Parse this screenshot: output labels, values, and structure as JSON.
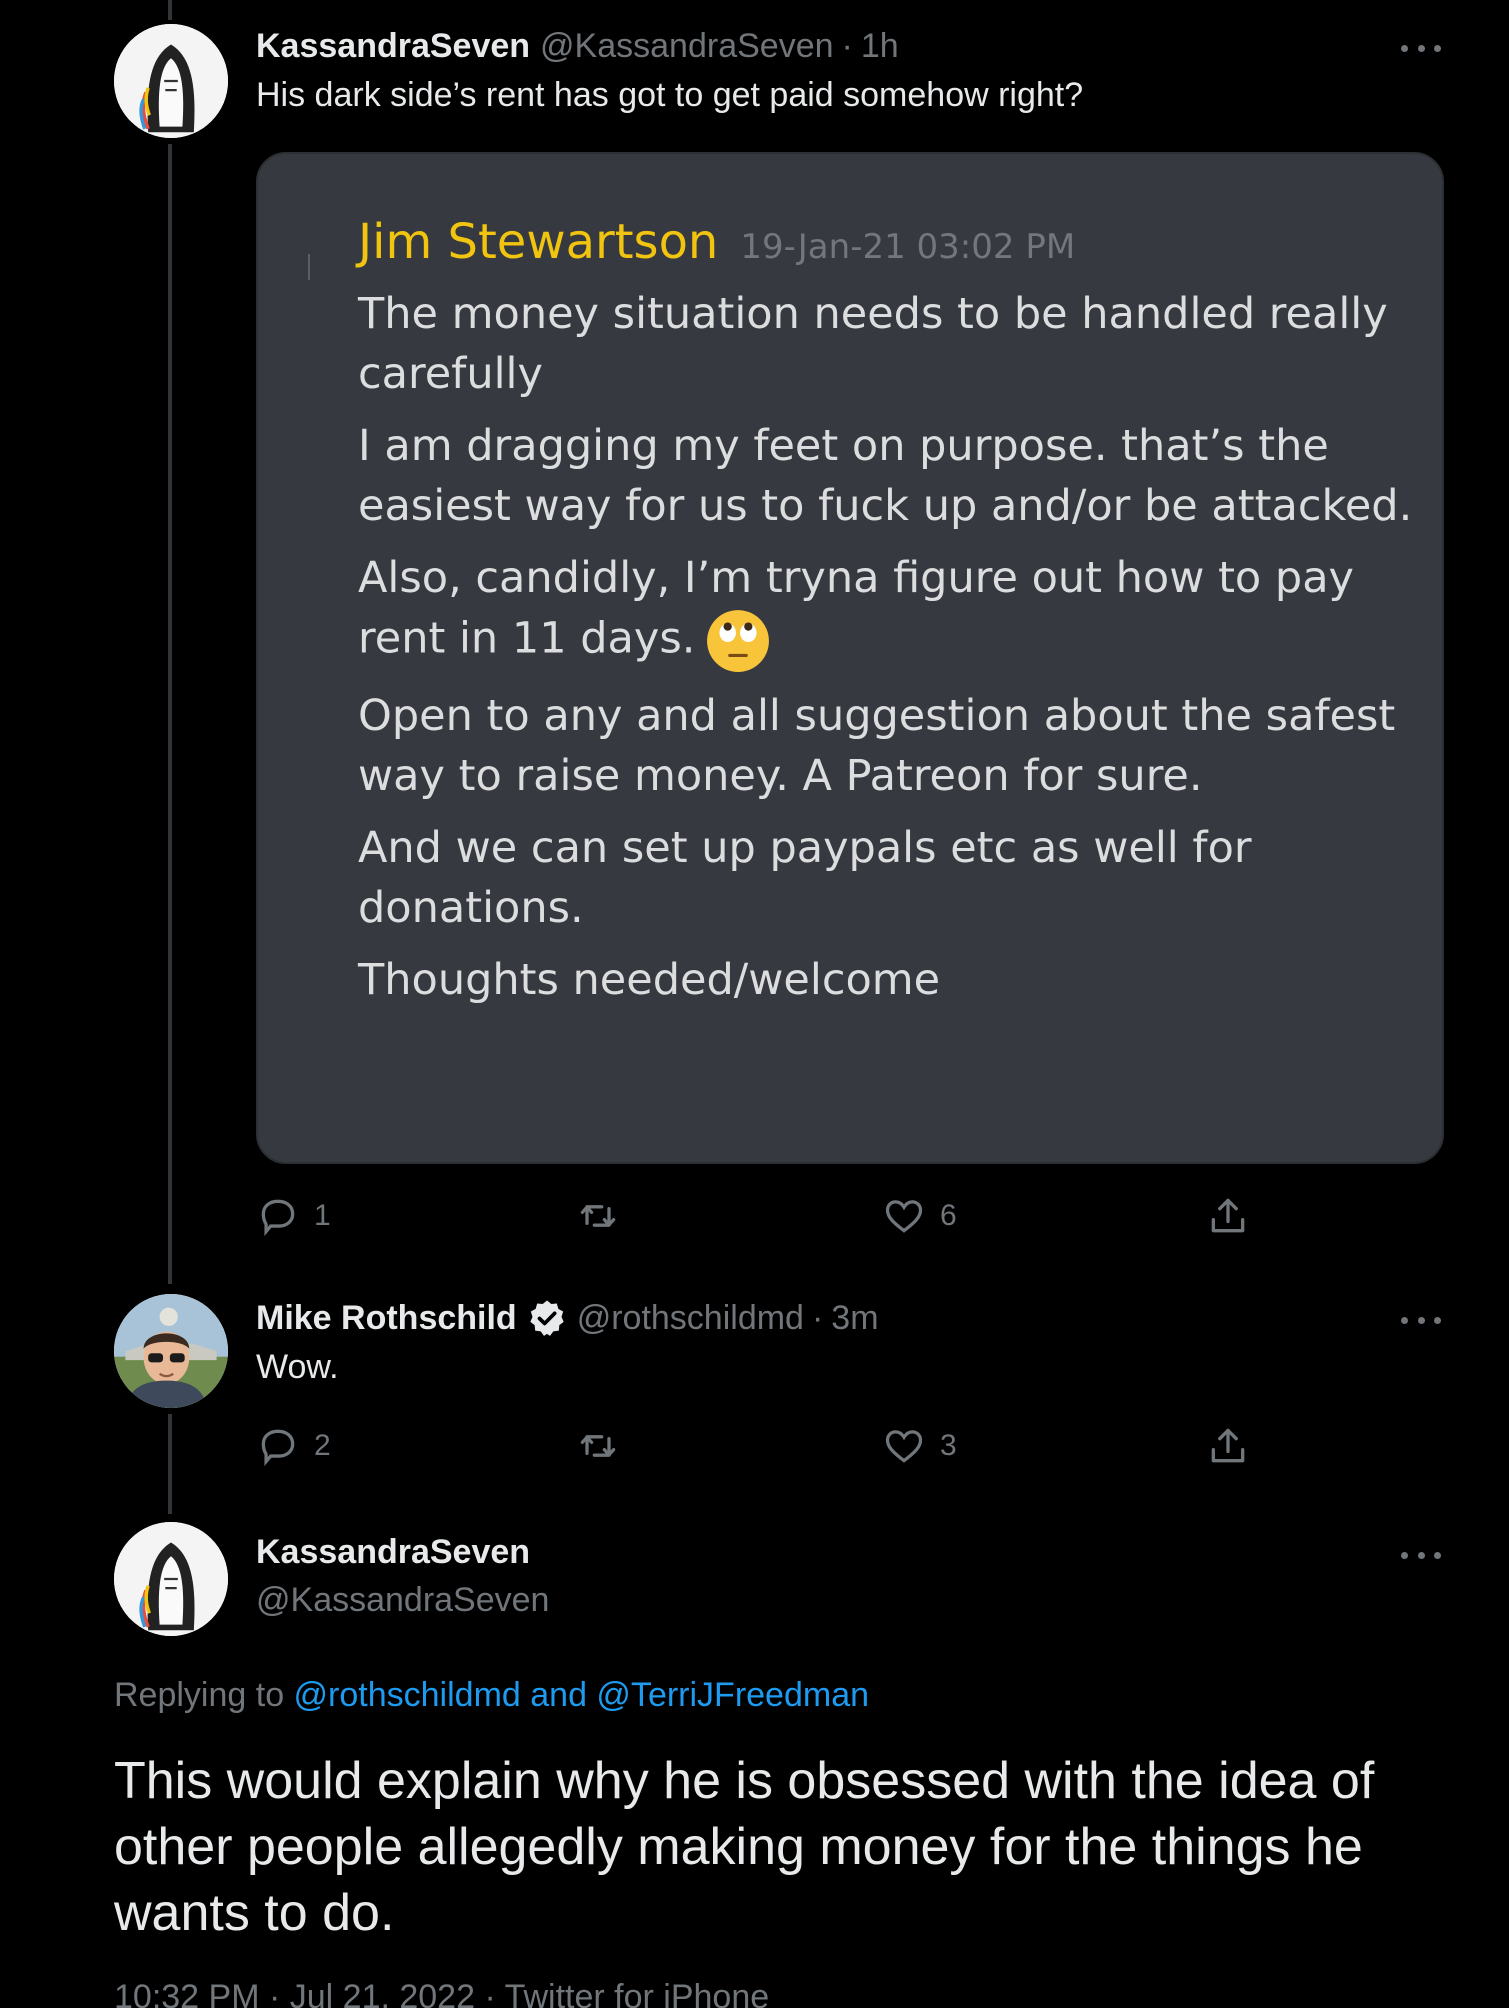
{
  "colors": {
    "background": "#000000",
    "text": "#e7e9ea",
    "muted": "#71767b",
    "link": "#1d9bf0",
    "card_bg": "#36393f",
    "card_author": "#f1c40f",
    "verified": "#e7e9ea"
  },
  "tweet1": {
    "name": "KassandraSeven",
    "handle": "@KassandraSeven",
    "sep": "·",
    "time": "1h",
    "text": "His dark side’s rent has got to get paid somehow right?",
    "more_icon": "more-horizontal-icon",
    "embed": {
      "author": "Jim Stewartson",
      "timestamp": "19-Jan-21 03:02 PM",
      "paragraphs": [
        "The money situation needs to be handled really carefully",
        "I am dragging my feet on purpose. that’s the easiest way for us to fuck up and/or be attacked.",
        "Also, candidly, I’m tryna figure out how to pay rent in 11 days.",
        "Open to any and all suggestion about the safest way to raise money. A Patreon for sure.",
        "And we can set up paypals etc as well for donations.",
        "Thoughts needed/welcome"
      ],
      "emoji": "face-with-rolling-eyes-icon"
    },
    "actions": {
      "reply_count": "1",
      "retweet_count": "",
      "like_count": "6"
    }
  },
  "tweet2": {
    "name": "Mike Rothschild",
    "handle": "@rothschildmd",
    "sep": "·",
    "time": "3m",
    "text": "Wow.",
    "verified_icon": "verified-badge-icon",
    "actions": {
      "reply_count": "2",
      "retweet_count": "",
      "like_count": "3"
    }
  },
  "tweet3": {
    "name": "KassandraSeven",
    "handle": "@KassandraSeven",
    "replying_prefix": "Replying to ",
    "replying_to": "@rothschildmd and @TerriJFreedman",
    "text": "This would explain why he is obsessed with the idea of other people allegedly making money for the things he wants to do.",
    "meta": "10:32 PM · Jul 21, 2022 · Twitter for iPhone"
  }
}
